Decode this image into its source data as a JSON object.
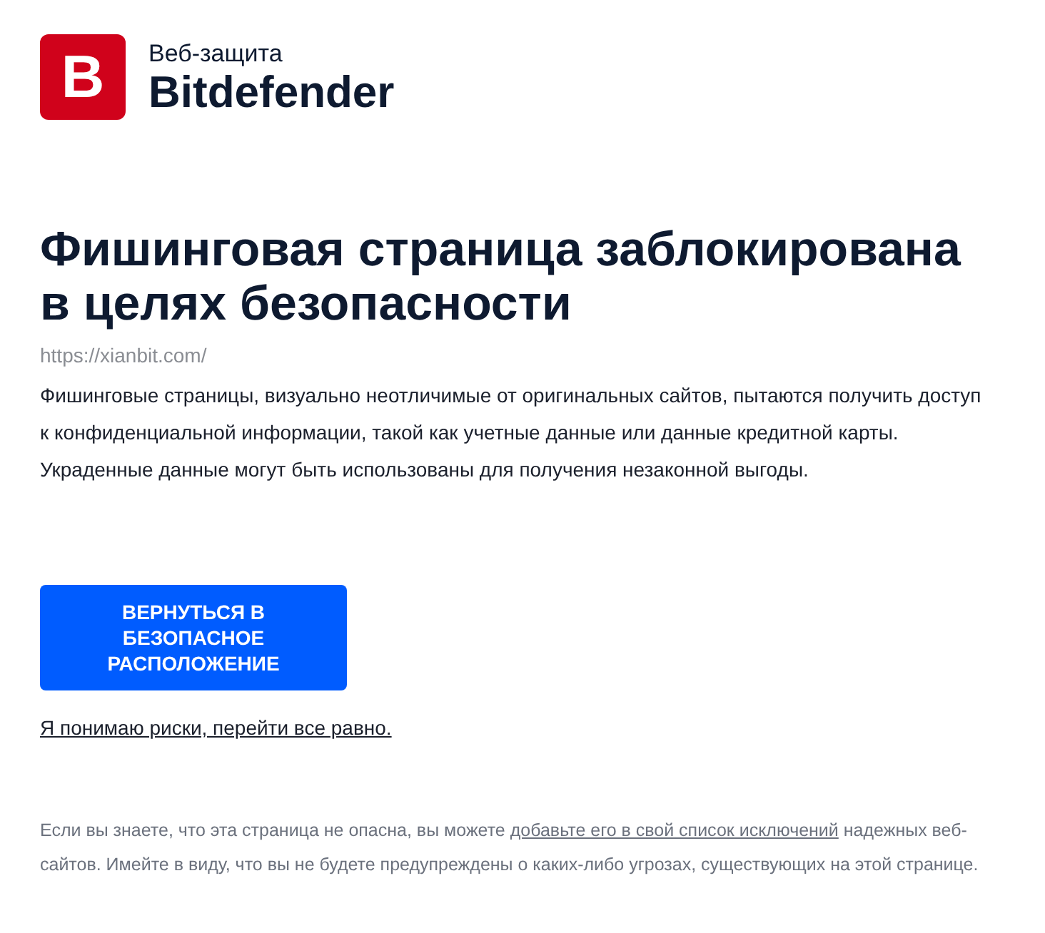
{
  "header": {
    "logo_mark": "B",
    "product": "Веб-защита",
    "brand": "Bitdefender"
  },
  "alert": {
    "title": "Фишинговая страница заблокирована в целях безопасности",
    "url": "https://xianbit.com/",
    "description": "Фишинговые страницы, визуально неотличимые от оригинальных сайтов, пытаются получить доступ к конфиденциальной информации, такой как учетные данные или данные кредитной карты. Украденные данные могут быть использованы для получения незаконной выгоды."
  },
  "actions": {
    "primary_button": "ВЕРНУТЬСЯ В БЕЗОПАСНОЕ РАСПОЛОЖЕНИЕ",
    "proceed_link": "Я понимаю риски, перейти все равно."
  },
  "footer": {
    "text_before": "Если вы знаете, что эта страница не опасна, вы можете",
    "link": "добавьте его в свой список исключений",
    "text_after": "надежных веб-сайтов. Имейте в виду, что вы не будете предупреждены о каких-либо угрозах, существующих на этой странице."
  }
}
